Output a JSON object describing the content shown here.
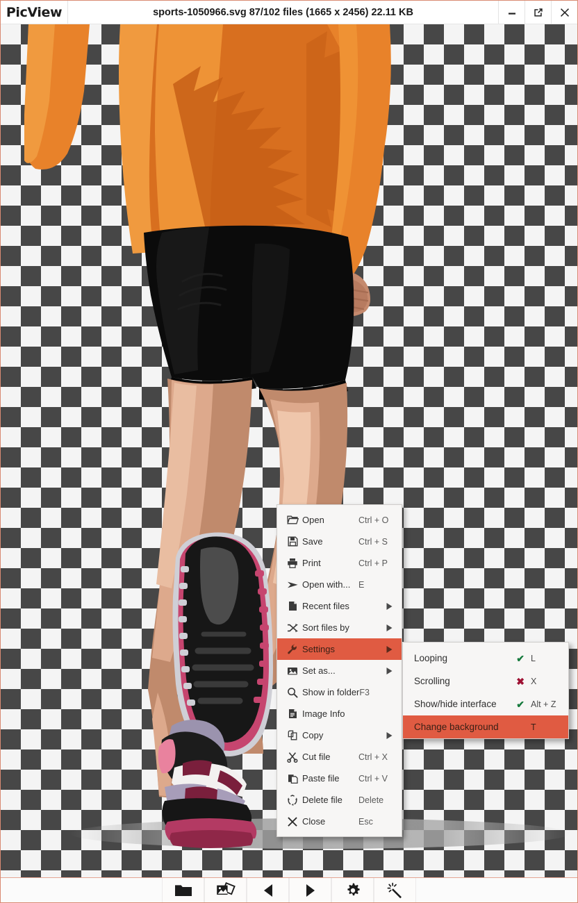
{
  "window": {
    "app_name": "PicView",
    "title": "sports-1050966.svg 87/102 files (1665 x 2456) 22.11 KB",
    "controls": [
      {
        "name": "minimize-button",
        "icon": "minimize-icon"
      },
      {
        "name": "restore-button",
        "icon": "open-external-icon"
      },
      {
        "name": "close-button",
        "icon": "close-icon"
      }
    ],
    "accent_color": "#e05b42",
    "border_color": "#d98a72"
  },
  "image": {
    "alt": "Vector illustration of a runner seen from behind wearing an orange long-sleeve top, black shorts and pink-white running shoes",
    "background": "transparent-checkerboard",
    "checker_light": "#f4f4f4",
    "checker_dark": "#474747",
    "checker_size_px": 29
  },
  "context_menu": {
    "items": [
      {
        "label": "Open",
        "accel": "Ctrl + O",
        "icon": "folder-open-icon",
        "submenu": false,
        "selected": false
      },
      {
        "label": "Save",
        "accel": "Ctrl + S",
        "icon": "save-icon",
        "submenu": false,
        "selected": false
      },
      {
        "label": "Print",
        "accel": "Ctrl + P",
        "icon": "printer-icon",
        "submenu": false,
        "selected": false
      },
      {
        "label": "Open with...",
        "accel": "E",
        "icon": "send-arrow-icon",
        "submenu": false,
        "selected": false
      },
      {
        "label": "Recent files",
        "accel": "",
        "icon": "document-icon",
        "submenu": true,
        "selected": false
      },
      {
        "label": "Sort files by",
        "accel": "",
        "icon": "shuffle-icon",
        "submenu": true,
        "selected": false
      },
      {
        "label": "Settings",
        "accel": "",
        "icon": "wrench-icon",
        "submenu": true,
        "selected": true
      },
      {
        "label": "Set as...",
        "accel": "",
        "icon": "picture-icon",
        "submenu": true,
        "selected": false
      },
      {
        "label": "Show in folder",
        "accel": "F3",
        "icon": "magnifier-icon",
        "submenu": false,
        "selected": false
      },
      {
        "label": "Image Info",
        "accel": "",
        "icon": "info-doc-icon",
        "submenu": false,
        "selected": false
      },
      {
        "label": "Copy",
        "accel": "",
        "icon": "copy-icon",
        "submenu": true,
        "selected": false
      },
      {
        "label": "Cut file",
        "accel": "Ctrl + X",
        "icon": "scissors-icon",
        "submenu": false,
        "selected": false
      },
      {
        "label": "Paste file",
        "accel": "Ctrl + V",
        "icon": "paste-icon",
        "submenu": false,
        "selected": false
      },
      {
        "label": "Delete file",
        "accel": "Delete",
        "icon": "recycle-bin-icon",
        "submenu": false,
        "selected": false
      },
      {
        "label": "Close",
        "accel": "Esc",
        "icon": "close-x-icon",
        "submenu": false,
        "selected": false
      }
    ]
  },
  "settings_submenu": {
    "items": [
      {
        "label": "Looping",
        "mark": "check",
        "key": "L",
        "selected": false
      },
      {
        "label": "Scrolling",
        "mark": "cross",
        "key": "X",
        "selected": false
      },
      {
        "label": "Show/hide interface",
        "mark": "check",
        "key": "Alt + Z",
        "selected": false
      },
      {
        "label": "Change background",
        "mark": "none",
        "key": "T",
        "selected": true
      }
    ],
    "check_color": "#167a3d",
    "cross_color": "#9e1133"
  },
  "toolbar": {
    "buttons": [
      {
        "name": "open-folder-button",
        "icon": "folder-icon"
      },
      {
        "name": "gallery-button",
        "icon": "gallery-icon"
      },
      {
        "name": "previous-button",
        "icon": "triangle-left-icon"
      },
      {
        "name": "next-button",
        "icon": "triangle-right-icon"
      },
      {
        "name": "settings-button",
        "icon": "gear-icon"
      },
      {
        "name": "effects-button",
        "icon": "magic-wand-icon"
      }
    ]
  }
}
